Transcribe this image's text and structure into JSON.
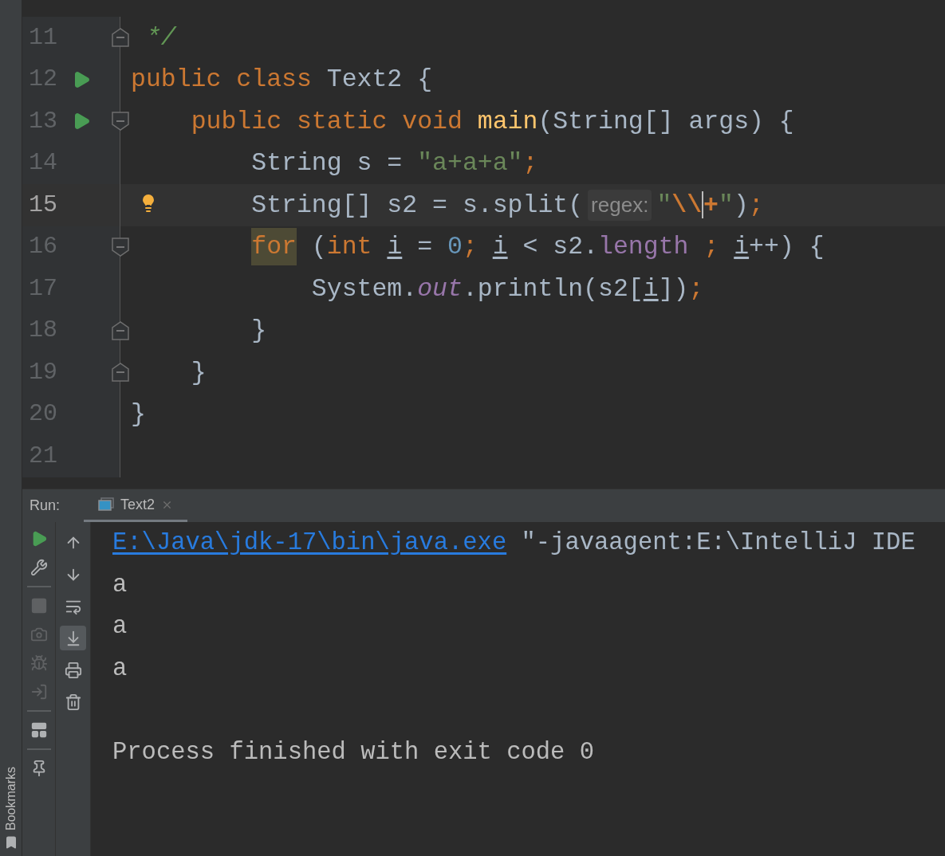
{
  "bookmarks_bar": {
    "label": "Bookmarks"
  },
  "editor": {
    "lines": [
      {
        "number": "11",
        "current": false,
        "run_marker": false,
        "fold_start": false,
        "fold_end": true,
        "bulb": false,
        "tokens": [
          {
            "kind": "comment",
            "text": " */"
          }
        ]
      },
      {
        "number": "12",
        "current": false,
        "run_marker": true,
        "fold_start": false,
        "fold_end": false,
        "bulb": false,
        "tokens": [
          {
            "kind": "keyword",
            "text": "public class "
          },
          {
            "kind": "plain",
            "text": "Text2 {"
          }
        ]
      },
      {
        "number": "13",
        "current": false,
        "run_marker": true,
        "fold_start": true,
        "fold_end": false,
        "bulb": false,
        "tokens": [
          {
            "kind": "keyword",
            "text": "    public static void "
          },
          {
            "kind": "method",
            "text": "main"
          },
          {
            "kind": "plain",
            "text": "(String[] args) {"
          }
        ]
      },
      {
        "number": "14",
        "current": false,
        "run_marker": false,
        "fold_start": false,
        "fold_end": false,
        "bulb": false,
        "tokens": [
          {
            "kind": "plain",
            "text": "        String s = "
          },
          {
            "kind": "string",
            "text": "\"a+a+a\""
          },
          {
            "kind": "keyword",
            "text": ";"
          }
        ]
      },
      {
        "number": "15",
        "current": true,
        "run_marker": false,
        "fold_start": false,
        "fold_end": false,
        "bulb": true,
        "tokens": [
          {
            "kind": "plain",
            "text": "        String[] s2 = s.split("
          },
          {
            "kind": "hint",
            "text": "regex:"
          },
          {
            "kind": "string",
            "text": "\""
          },
          {
            "kind": "escape",
            "text": "\\\\"
          },
          {
            "kind": "caret"
          },
          {
            "kind": "escape",
            "text": "+"
          },
          {
            "kind": "string",
            "text": "\""
          },
          {
            "kind": "plain",
            "text": ")"
          },
          {
            "kind": "keyword",
            "text": ";"
          }
        ]
      },
      {
        "number": "16",
        "current": false,
        "run_marker": false,
        "fold_start": true,
        "fold_end": false,
        "bulb": false,
        "tokens": [
          {
            "kind": "keyword_highlight",
            "text": "        for"
          },
          {
            "kind": "plain",
            "text": " ("
          },
          {
            "kind": "keyword",
            "text": "int "
          },
          {
            "kind": "variable",
            "text": "i"
          },
          {
            "kind": "plain",
            "text": " = "
          },
          {
            "kind": "number",
            "text": "0"
          },
          {
            "kind": "keyword",
            "text": "; "
          },
          {
            "kind": "variable",
            "text": "i"
          },
          {
            "kind": "plain",
            "text": " < s2."
          },
          {
            "kind": "field",
            "text": "length"
          },
          {
            "kind": "keyword",
            "text": " ; "
          },
          {
            "kind": "variable",
            "text": "i"
          },
          {
            "kind": "plain",
            "text": "++) {"
          }
        ]
      },
      {
        "number": "17",
        "current": false,
        "run_marker": false,
        "fold_start": false,
        "fold_end": false,
        "bulb": false,
        "tokens": [
          {
            "kind": "plain",
            "text": "            System."
          },
          {
            "kind": "static_field",
            "text": "out"
          },
          {
            "kind": "plain",
            "text": ".println(s2["
          },
          {
            "kind": "variable",
            "text": "i"
          },
          {
            "kind": "plain",
            "text": "])"
          },
          {
            "kind": "keyword",
            "text": ";"
          }
        ]
      },
      {
        "number": "18",
        "current": false,
        "run_marker": false,
        "fold_start": false,
        "fold_end": true,
        "bulb": false,
        "tokens": [
          {
            "kind": "plain",
            "text": "        }"
          }
        ]
      },
      {
        "number": "19",
        "current": false,
        "run_marker": false,
        "fold_start": false,
        "fold_end": true,
        "bulb": false,
        "tokens": [
          {
            "kind": "plain",
            "text": "    }"
          }
        ]
      },
      {
        "number": "20",
        "current": false,
        "run_marker": false,
        "fold_start": false,
        "fold_end": false,
        "bulb": false,
        "tokens": [
          {
            "kind": "plain",
            "text": "}"
          }
        ]
      },
      {
        "number": "21",
        "current": false,
        "run_marker": false,
        "fold_start": false,
        "fold_end": false,
        "bulb": false
      }
    ]
  },
  "run_panel": {
    "label": "Run:",
    "tabs": [
      {
        "label": "Text2",
        "selected": true
      }
    ],
    "left_toolbar": [
      {
        "kind": "run",
        "disabled": false
      },
      {
        "kind": "settings",
        "disabled": false
      },
      {
        "kind": "separator"
      },
      {
        "kind": "stop",
        "disabled": true
      },
      {
        "kind": "camera",
        "disabled": true
      },
      {
        "kind": "bug",
        "disabled": true
      },
      {
        "kind": "login",
        "disabled": true
      },
      {
        "kind": "separator"
      },
      {
        "kind": "layout",
        "disabled": false
      },
      {
        "kind": "separator"
      },
      {
        "kind": "pin",
        "disabled": false
      }
    ],
    "right_toolbar": [
      {
        "kind": "up",
        "selected": false
      },
      {
        "kind": "down",
        "selected": false
      },
      {
        "kind": "wrap",
        "selected": false
      },
      {
        "kind": "scroll_end",
        "selected": true
      },
      {
        "kind": "print",
        "selected": false
      },
      {
        "kind": "trash",
        "selected": false
      }
    ],
    "console": [
      {
        "kind": "command",
        "tokens": [
          {
            "kind": "link",
            "text": "E:\\Java\\jdk-17\\bin\\java.exe"
          },
          {
            "kind": "plain",
            "text": " \"-javaagent:E:\\IntelliJ IDE"
          }
        ]
      },
      {
        "kind": "output",
        "text": "a"
      },
      {
        "kind": "output",
        "text": "a"
      },
      {
        "kind": "output",
        "text": "a"
      },
      {
        "kind": "exit",
        "text": "Process finished with exit code 0"
      }
    ]
  }
}
